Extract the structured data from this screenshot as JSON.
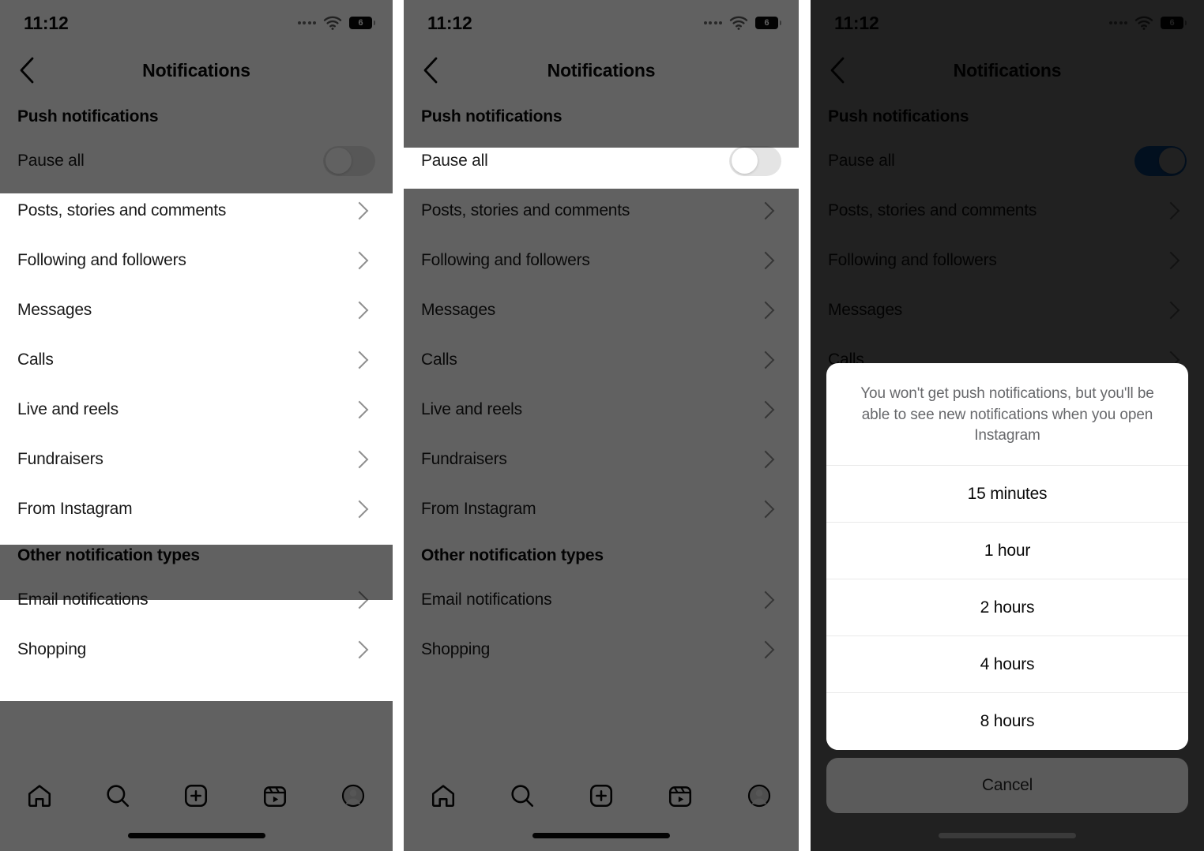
{
  "status_bar": {
    "time": "11:12",
    "battery_level": "6",
    "wifi_icon": "wifi-icon",
    "signal_icon": "signal-dots-icon",
    "battery_icon": "battery-icon"
  },
  "nav": {
    "title": "Notifications",
    "back_icon": "chevron-left-icon"
  },
  "sections": [
    {
      "header": "Push notifications",
      "toggle_row": {
        "label": "Pause all"
      },
      "items": [
        {
          "label": "Posts, stories and comments"
        },
        {
          "label": "Following and followers"
        },
        {
          "label": "Messages"
        },
        {
          "label": "Calls"
        },
        {
          "label": "Live and reels"
        },
        {
          "label": "Fundraisers"
        },
        {
          "label": "From Instagram"
        }
      ]
    },
    {
      "header": "Other notification types",
      "items": [
        {
          "label": "Email notifications"
        },
        {
          "label": "Shopping"
        }
      ]
    }
  ],
  "tabbar": {
    "items": [
      {
        "icon": "home-icon",
        "label": "Home"
      },
      {
        "icon": "search-icon",
        "label": "Search"
      },
      {
        "icon": "add-post-icon",
        "label": "Create"
      },
      {
        "icon": "reels-icon",
        "label": "Reels"
      },
      {
        "icon": "profile-avatar-icon",
        "label": "Profile"
      }
    ]
  },
  "panels": [
    {
      "id": "panel-1",
      "pause_all_state": "off",
      "highlight": "notification-lists"
    },
    {
      "id": "panel-2",
      "pause_all_state": "off",
      "highlight": "pause-all-row"
    },
    {
      "id": "panel-3",
      "pause_all_state": "on",
      "highlight": "action-sheet"
    }
  ],
  "action_sheet": {
    "message": "You won't get push notifications, but you'll be able to see new notifications when you open Instagram",
    "options": [
      {
        "label": "15 minutes"
      },
      {
        "label": "1 hour"
      },
      {
        "label": "2 hours"
      },
      {
        "label": "4 hours"
      },
      {
        "label": "8 hours"
      }
    ],
    "cancel_label": "Cancel"
  },
  "colors": {
    "toggle_on": "#1479ea",
    "toggle_off_track": "#e4e4e4",
    "chevron": "#8e8e8e",
    "text_primary": "#1a1a1a",
    "sheet_msg": "#67686b",
    "cancel_bg": "#5b5b5b"
  }
}
